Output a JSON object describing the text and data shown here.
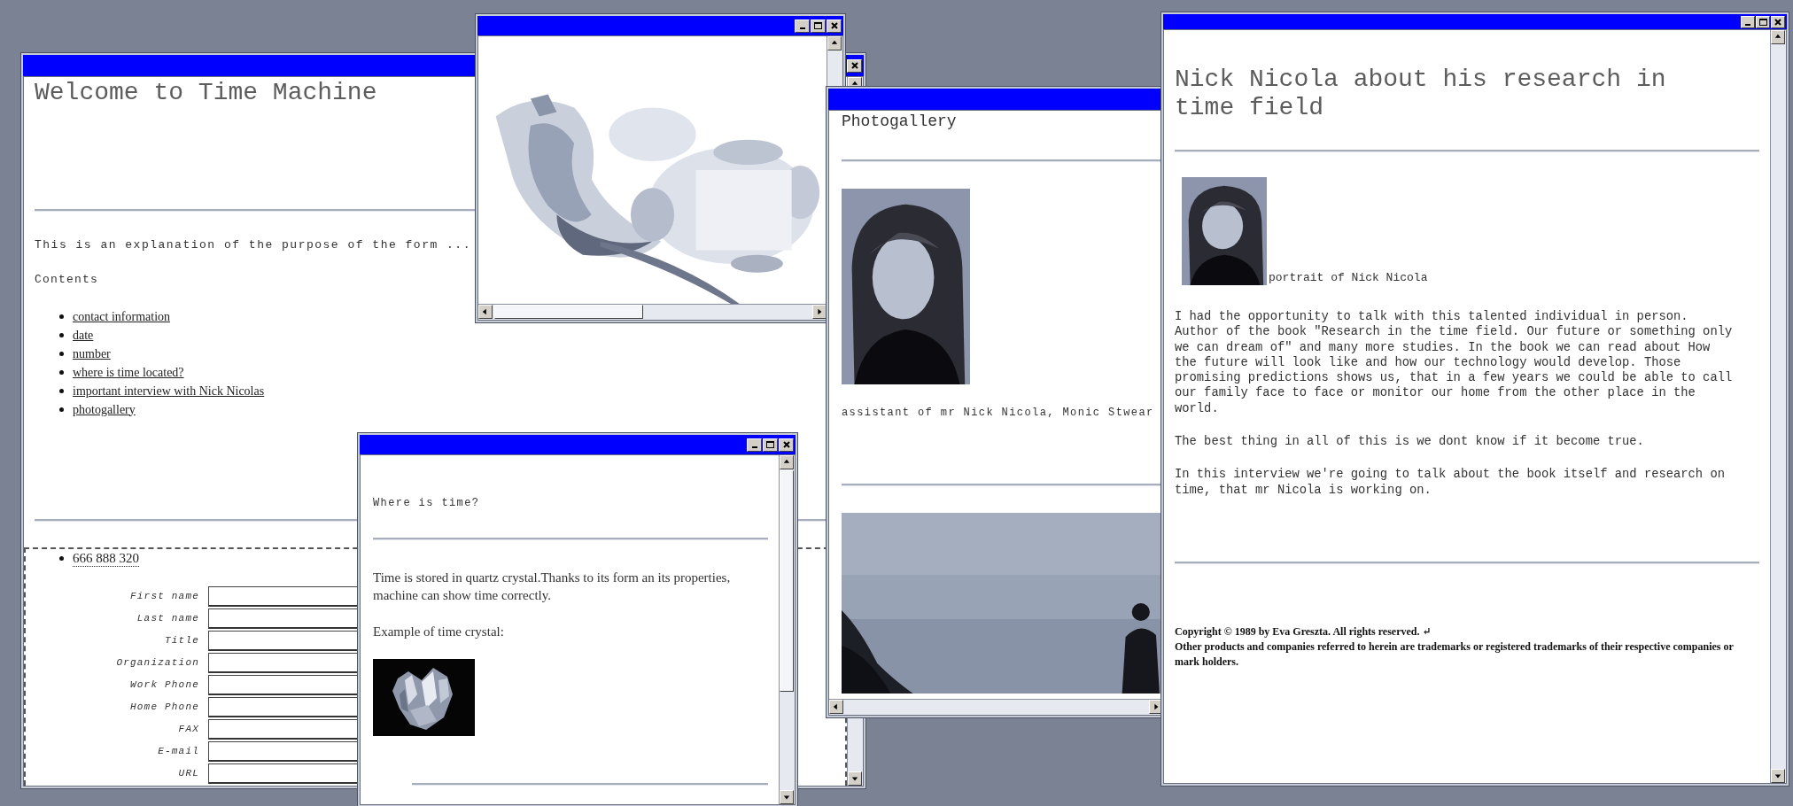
{
  "home_window": {
    "controls": [
      {
        "kind": "close"
      }
    ],
    "heading": "Welcome to Time Machine",
    "intro": "This is an explanation of the purpose of the form ...",
    "contents_label": "Contents",
    "contents_links": [
      "contact information",
      "date",
      "number",
      "where is time located?",
      "important interview with Nick Nicolas",
      "photogallery"
    ],
    "phone": "666 888 320",
    "form_fields": [
      "First name",
      "Last name",
      "Title",
      "Organization",
      "Work Phone",
      "Home Phone",
      "FAX",
      "E-mail",
      "URL"
    ]
  },
  "map_window": {
    "controls": [
      {
        "kind": "minimize"
      },
      {
        "kind": "maximize"
      },
      {
        "kind": "close"
      }
    ]
  },
  "crystal_window": {
    "controls": [
      {
        "kind": "minimize"
      },
      {
        "kind": "maximize"
      },
      {
        "kind": "close"
      }
    ],
    "heading": "Where is time?",
    "paragraph": "Time is stored in quartz crystal.Thanks to its form an its properties, machine can show time correctly.",
    "caption": "Example of time crystal:"
  },
  "gallery_window": {
    "heading": "Photogallery",
    "caption": "assistant of mr Nick Nicola, Monic Stwear"
  },
  "interview_window": {
    "controls": [
      {
        "kind": "minimize"
      },
      {
        "kind": "maximize"
      },
      {
        "kind": "close"
      }
    ],
    "heading": "Nick Nicola about his research in time field",
    "portrait_caption": "portrait of Nick Nicola",
    "paragraphs": [
      "I had the opportunity to talk with this talented individual in person. Author of the book \"Research in the time field. Our future or something only we can dream of\" and many more studies. In the book we can read about How the future will look like and how our technology would develop. Those promising predictions shows us, that in a few years we could be able to call our family face to face or monitor our home from the other place in the world.",
      "The best thing in all of this is we dont know if it become true.",
      "In this interview we're going to talk about the book itself and research on time, that mr Nicola is working on."
    ],
    "copyright": [
      "Copyright © 1989 by Eva Greszta. All rights reserved. ↵",
      "Other products and companies referred to herein are trademarks or registered trademarks of their respective companies or mark holders."
    ]
  }
}
